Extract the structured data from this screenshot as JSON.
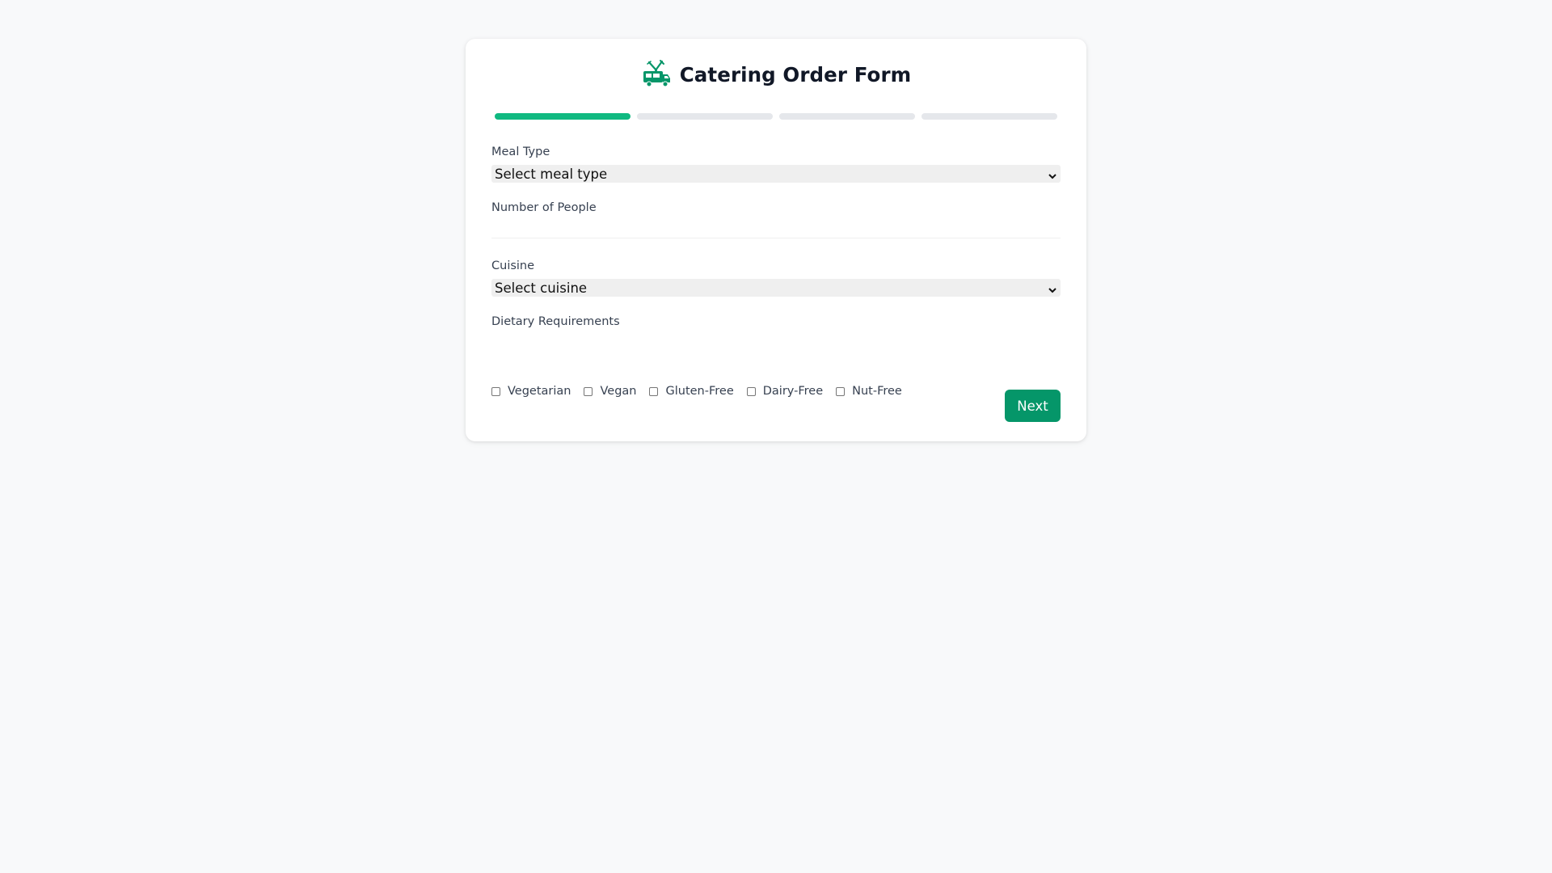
{
  "form": {
    "title": "Catering Order Form",
    "logo_icon": "food-truck-icon",
    "accent_color": "#10b981",
    "button_color": "#059669",
    "progress": {
      "total_steps": 4,
      "current_step": 1
    },
    "fields": {
      "meal_type": {
        "label": "Meal Type",
        "selected": "Select meal type"
      },
      "people": {
        "label": "Number of People",
        "value": "",
        "placeholder": ""
      },
      "cuisine": {
        "label": "Cuisine",
        "selected": "Select cuisine"
      },
      "dietary": {
        "label": "Dietary Requirements",
        "options": [
          "Vegetarian",
          "Vegan",
          "Gluten-Free",
          "Dairy-Free",
          "Nut-Free"
        ],
        "checked": [
          false,
          false,
          false,
          false,
          false
        ]
      }
    },
    "next_label": "Next"
  }
}
